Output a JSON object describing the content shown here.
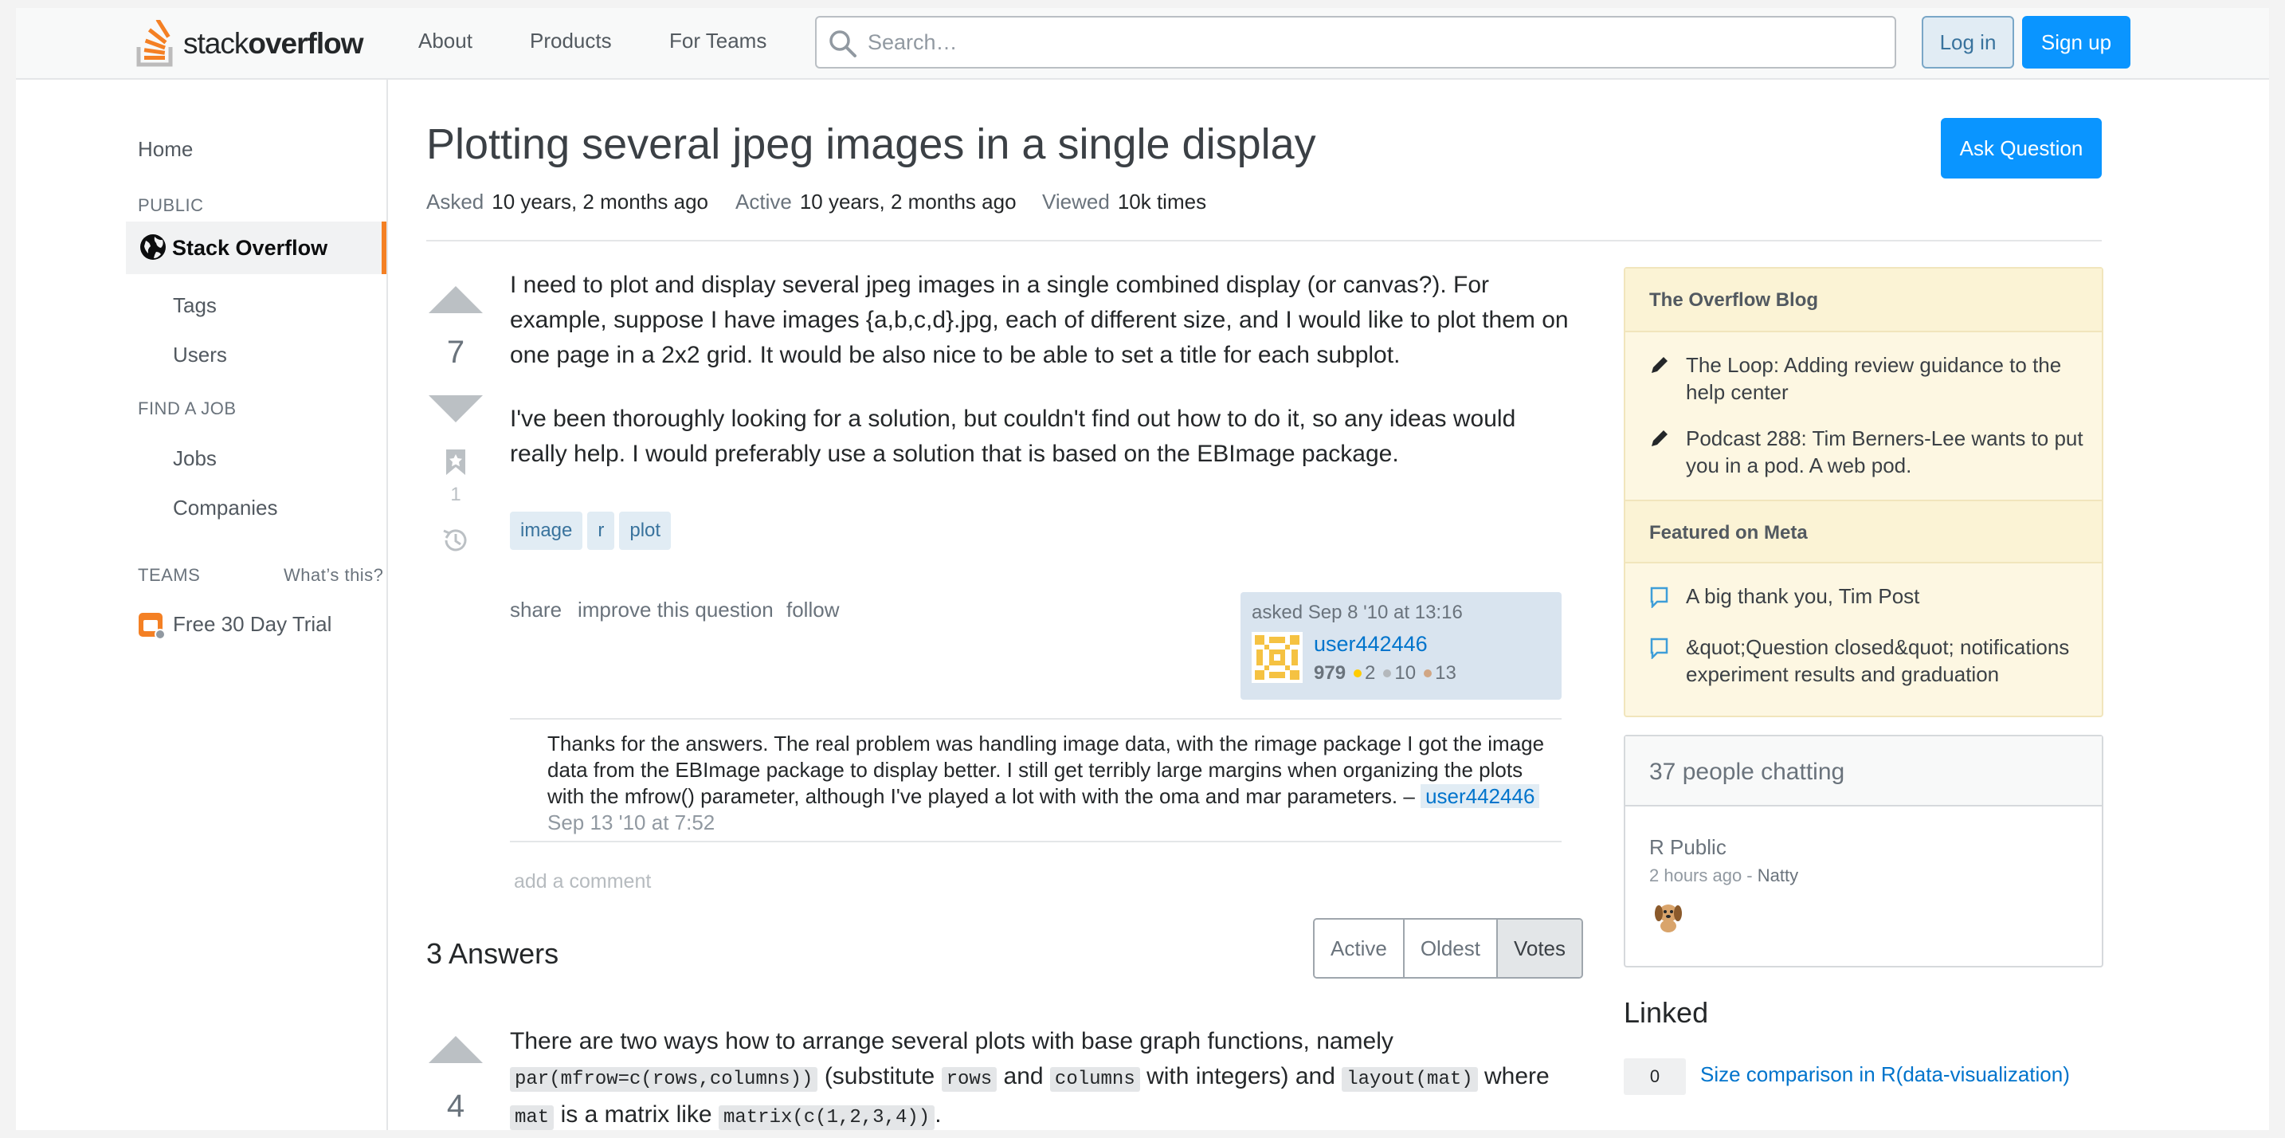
{
  "header": {
    "logo": {
      "prefix": "stack",
      "suffix": "overflow"
    },
    "nav": [
      "About",
      "Products",
      "For Teams"
    ],
    "search_placeholder": "Search…",
    "login_label": "Log in",
    "signup_label": "Sign up"
  },
  "sidebar": {
    "home": "Home",
    "public_heading": "PUBLIC",
    "active_site": "Stack Overflow",
    "items": [
      "Tags",
      "Users"
    ],
    "job_heading": "FIND A JOB",
    "job_items": [
      "Jobs",
      "Companies"
    ],
    "teams_heading": "TEAMS",
    "whats_this": "What’s this?",
    "trial": "Free 30 Day Trial"
  },
  "question": {
    "title": "Plotting several jpeg images in a single display",
    "ask_button": "Ask Question",
    "meta": {
      "asked_label": "Asked",
      "asked_value": "10 years, 2 months ago",
      "active_label": "Active",
      "active_value": "10 years, 2 months ago",
      "viewed_label": "Viewed",
      "viewed_value": "10k times"
    },
    "score": "7",
    "bookmarks": "1",
    "body_p1": "I need to plot and display several jpeg images in a single combined display (or canvas?). For example, suppose I have images {a,b,c,d}.jpg, each of different size, and I would like to plot them on one page in a 2x2 grid. It would be also nice to be able to set a title for each subplot.",
    "body_p2": "I've been thoroughly looking for a solution, but couldn't find out how to do it, so any ideas would really help. I would preferably use a solution that is based on the EBImage package.",
    "tags": [
      "image",
      "r",
      "plot"
    ],
    "menu": [
      "share",
      "improve this question",
      "follow"
    ],
    "owner": {
      "asked": "asked Sep 8 '10 at 13:16",
      "name": "user442446",
      "rep": "979",
      "gold": "2",
      "silver": "10",
      "bronze": "13"
    },
    "comment": {
      "text": "Thanks for the answers. The real problem was handling image data, with the rimage package I got the image data from the EBImage package to display better. I still get terribly large margins when organizing the plots with the mfrow() parameter, although I've played a lot with with the oma and mar parameters. –",
      "user": "user442446",
      "time": "Sep 13 '10 at 7:52"
    },
    "add_comment": "add a comment"
  },
  "answers": {
    "heading": "3 Answers",
    "sort": [
      "Active",
      "Oldest",
      "Votes"
    ],
    "first": {
      "score": "4",
      "t1": "There are two ways how to arrange several plots with base graph functions, namely",
      "c1": "par(mfrow=c(rows,columns))",
      "t2": "(substitute",
      "c2": "rows",
      "t3": "and",
      "c3": "columns",
      "t4": "with integers) and",
      "c4": "layout(mat)",
      "t5": "where",
      "c5": "mat",
      "t6": "is a matrix like",
      "c6": "matrix(c(1,2,3,4))",
      "t7": "."
    }
  },
  "right": {
    "blog_heading": "The Overflow Blog",
    "blog_items": [
      "The Loop: Adding review guidance to the help center",
      "Podcast 288: Tim Berners-Lee wants to put you in a pod. A web pod."
    ],
    "meta_heading": "Featured on Meta",
    "meta_items": [
      "A big thank you, Tim Post",
      "&quot;Question closed&quot; notifications experiment results and graduation"
    ],
    "chat": {
      "heading": "37 people chatting",
      "room": "R Public",
      "time": "2 hours ago -",
      "user": "Natty"
    },
    "linked_heading": "Linked",
    "linked": {
      "count": "0",
      "title": "Size comparison in R(data-visualization)"
    }
  },
  "colors": {
    "accent": "#f48024",
    "link": "#0074cc",
    "primary_button": "#0a95ff",
    "gold": "#ffcc01",
    "silver": "#b4b8bc",
    "bronze": "#d1a684"
  }
}
